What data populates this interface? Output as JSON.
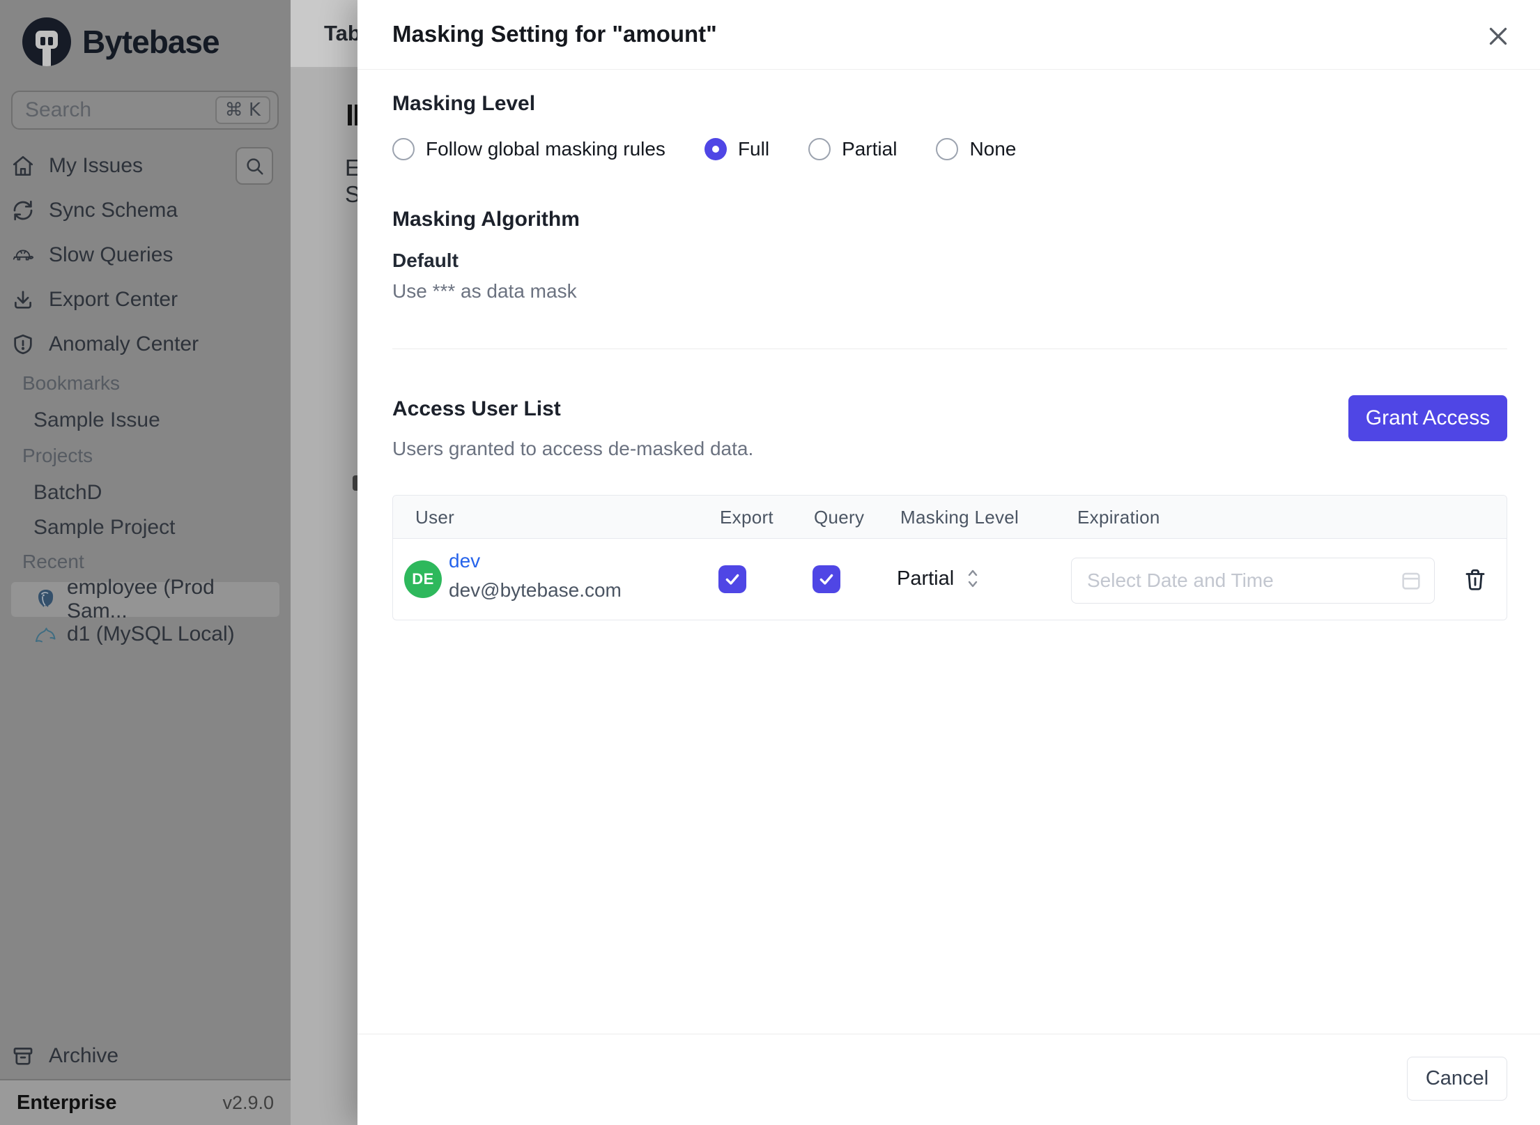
{
  "app": {
    "plan": "Enterprise",
    "version": "v2.9.0",
    "brand": "Bytebase"
  },
  "sidebar": {
    "search": {
      "placeholder": "Search",
      "shortcut": "⌘ K"
    },
    "nav": [
      {
        "icon": "home-icon",
        "label": "My Issues"
      },
      {
        "icon": "sync-icon",
        "label": "Sync Schema"
      },
      {
        "icon": "turtle-icon",
        "label": "Slow Queries"
      },
      {
        "icon": "download-icon",
        "label": "Export Center"
      },
      {
        "icon": "shield-icon",
        "label": "Anomaly Center"
      }
    ],
    "sections": [
      {
        "label": "Bookmarks",
        "items": [
          {
            "label": "Sample Issue"
          }
        ]
      },
      {
        "label": "Projects",
        "items": [
          {
            "label": "BatchD"
          },
          {
            "label": "Sample Project"
          }
        ]
      },
      {
        "label": "Recent",
        "items": [
          {
            "label": "employee (Prod Sam...",
            "icon": "postgresql-icon",
            "selected": true
          },
          {
            "label": "d1 (MySQL Local)",
            "icon": "mysql-icon",
            "selected": false
          }
        ]
      }
    ],
    "archive_label": "Archive"
  },
  "background": {
    "tab_label": "Tab",
    "letters": [
      "E",
      "S"
    ]
  },
  "modal": {
    "title": "Masking Setting for \"amount\"",
    "close_icon": "close-icon",
    "accent_color": "#4f46e5",
    "masking_level": {
      "heading": "Masking Level",
      "options": [
        {
          "label": "Follow global masking rules",
          "selected": false
        },
        {
          "label": "Full",
          "selected": true
        },
        {
          "label": "Partial",
          "selected": false
        },
        {
          "label": "None",
          "selected": false
        }
      ]
    },
    "masking_algorithm": {
      "heading": "Masking Algorithm",
      "name": "Default",
      "description": "Use *** as data mask"
    },
    "access_user_list": {
      "heading": "Access User List",
      "subtitle": "Users granted to access de-masked data.",
      "grant_button": "Grant Access",
      "table": {
        "columns": [
          "User",
          "Export",
          "Query",
          "Masking Level",
          "Expiration"
        ],
        "rows": [
          {
            "avatar_initials": "DE",
            "avatar_color": "#2eb85c",
            "name": "dev",
            "name_color": "#2563eb",
            "email": "dev@bytebase.com",
            "export": true,
            "query": true,
            "masking_level": "Partial",
            "expiration_placeholder": "Select Date and Time"
          }
        ]
      }
    },
    "footer": {
      "cancel_label": "Cancel"
    }
  }
}
